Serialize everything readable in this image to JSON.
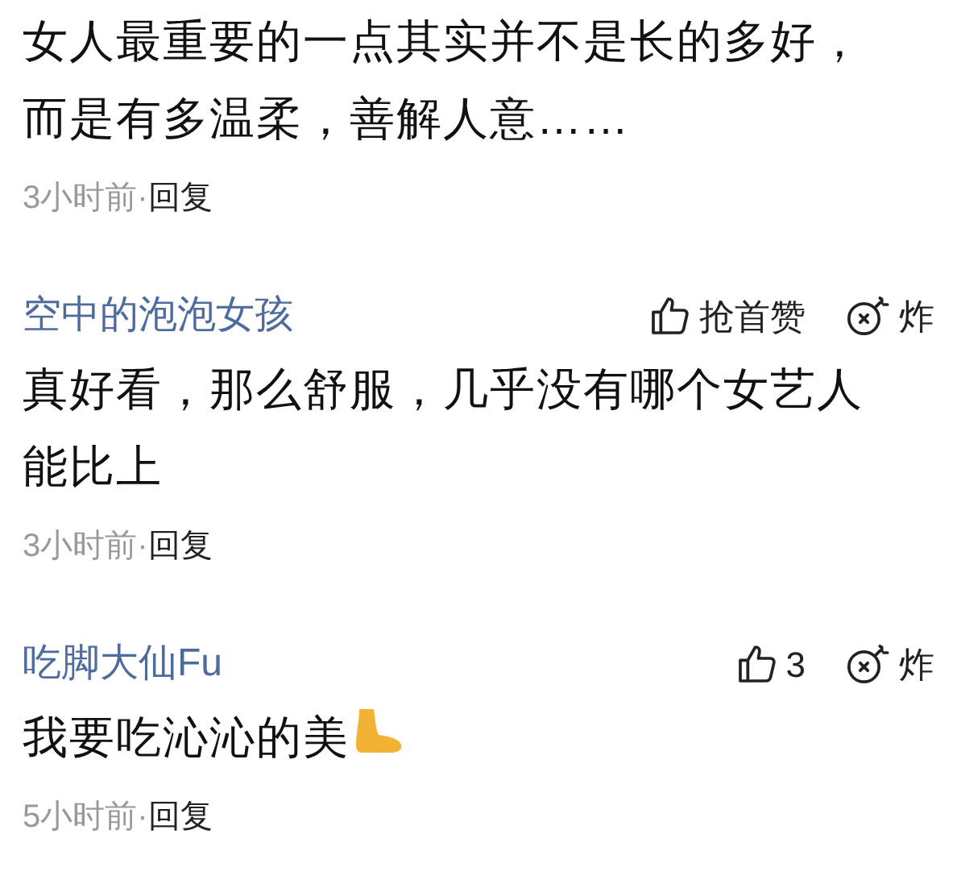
{
  "comments": [
    {
      "lines": [
        "女人最重要的一点其实并不是长的多好，",
        "而是有多温柔，善解人意……"
      ],
      "time": "3小时前",
      "separator": "·",
      "reply": "回复"
    },
    {
      "author": "空中的泡泡女孩",
      "like": "抢首赞",
      "bomb": "炸",
      "lines": [
        "真好看，那么舒服，几乎没有哪个女艺人",
        "能比上"
      ],
      "time": "3小时前",
      "separator": "·",
      "reply": "回复"
    },
    {
      "author": "吃脚大仙Fu",
      "like": "3",
      "bomb": "炸",
      "lines": [
        "我要吃沁沁的美"
      ],
      "foot_emoji": true,
      "time": "5小时前",
      "separator": "·",
      "reply": "回复"
    }
  ]
}
